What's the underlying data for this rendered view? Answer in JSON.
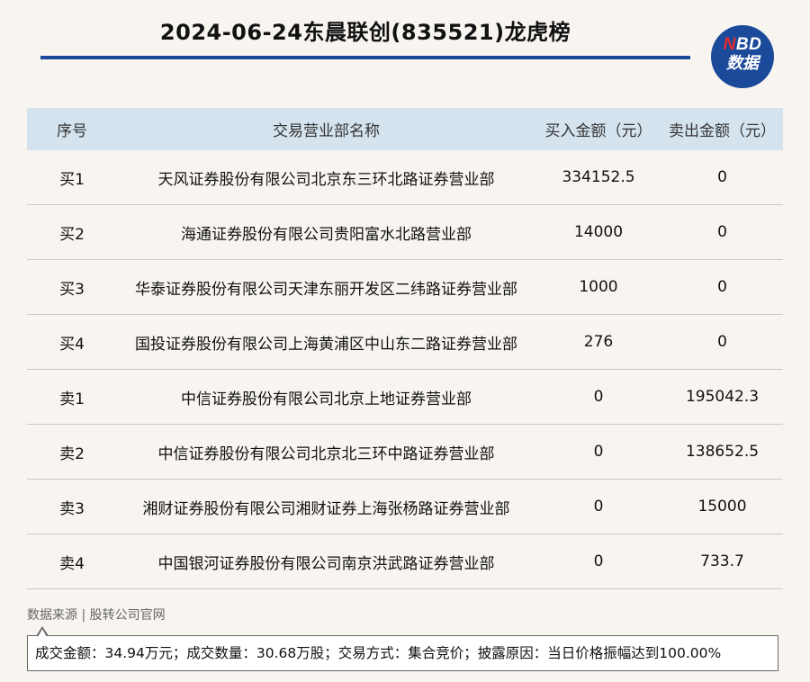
{
  "header": {
    "title": "2024-06-24东晨联创(835521)龙虎榜",
    "logo_top": "BD",
    "logo_top_accent": "N",
    "logo_bottom": "数据"
  },
  "table": {
    "columns": [
      "序号",
      "交易营业部名称",
      "买入金额（元）",
      "卖出金额（元）"
    ],
    "rows": [
      {
        "seq": "买1",
        "name": "天风证券股份有限公司北京东三环北路证券营业部",
        "buy": "334152.5",
        "sell": "0"
      },
      {
        "seq": "买2",
        "name": "海通证券股份有限公司贵阳富水北路营业部",
        "buy": "14000",
        "sell": "0"
      },
      {
        "seq": "买3",
        "name": "华泰证券股份有限公司天津东丽开发区二纬路证券营业部",
        "buy": "1000",
        "sell": "0"
      },
      {
        "seq": "买4",
        "name": "国投证券股份有限公司上海黄浦区中山东二路证券营业部",
        "buy": "276",
        "sell": "0"
      },
      {
        "seq": "卖1",
        "name": "中信证券股份有限公司北京上地证券营业部",
        "buy": "0",
        "sell": "195042.3"
      },
      {
        "seq": "卖2",
        "name": "中信证券股份有限公司北京北三环中路证券营业部",
        "buy": "0",
        "sell": "138652.5"
      },
      {
        "seq": "卖3",
        "name": "湘财证券股份有限公司湘财证券上海张杨路证券营业部",
        "buy": "0",
        "sell": "15000"
      },
      {
        "seq": "卖4",
        "name": "中国银河证券股份有限公司南京洪武路证券营业部",
        "buy": "0",
        "sell": "733.7"
      }
    ]
  },
  "footer": {
    "source": "数据来源 | 股转公司官网",
    "note": "成交金额：34.94万元；成交数量：30.68万股；交易方式：集合竞价；披露原因：当日价格振幅达到100.00%"
  },
  "colors": {
    "accent": "#1b4a9a",
    "header_bg": "#d5e3ee",
    "page_bg": "#f8f5f1",
    "logo_accent": "#e32b2b"
  }
}
